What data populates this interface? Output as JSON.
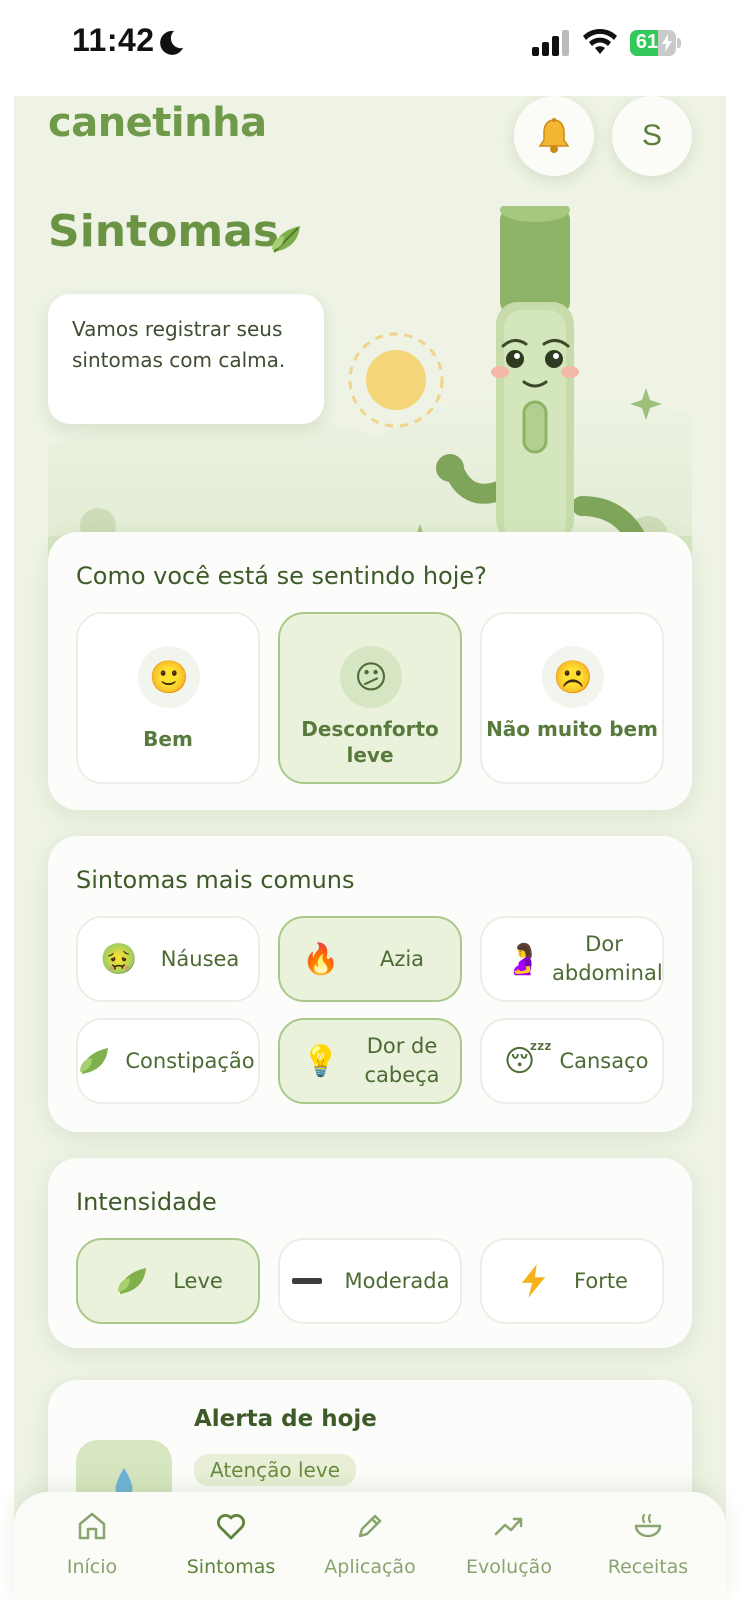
{
  "status_bar": {
    "time": "11:42",
    "battery_percent": 61,
    "battery_label": "61",
    "icons": [
      "moon-icon",
      "signal-icon",
      "wifi-icon",
      "battery-charging-icon"
    ]
  },
  "header": {
    "logo": "canetinha",
    "bell_icon": "bell-icon",
    "avatar_letter": "S"
  },
  "hero": {
    "title": "Sintomas",
    "speech": "Vamos registrar seus sintomas com calma.",
    "mascot": "pen-mascot-illustration"
  },
  "mood_card": {
    "title": "Como você está se sentindo hoje?",
    "options": [
      {
        "label": "Bem",
        "emoji": "🙂",
        "selected": false
      },
      {
        "label": "Desconforto leve",
        "emoji": "😕",
        "selected": true
      },
      {
        "label": "Não muito bem",
        "emoji": "☹️",
        "selected": false
      }
    ]
  },
  "symptoms_card": {
    "title": "Sintomas mais comuns",
    "chips": [
      {
        "label": "Náusea",
        "icon": "nauseated-face-icon",
        "selected": false
      },
      {
        "label": "Azia",
        "icon": "fire-icon",
        "selected": true
      },
      {
        "label": "Dor abdominal",
        "icon": "person-stomach-icon",
        "selected": false
      },
      {
        "label": "Constipação",
        "icon": "leaf-icon",
        "selected": false
      },
      {
        "label": "Dor de cabeça",
        "icon": "lightbulb-icon",
        "selected": true
      },
      {
        "label": "Cansaço",
        "icon": "sleeping-face-icon",
        "selected": false
      }
    ]
  },
  "intensity_card": {
    "title": "Intensidade",
    "options": [
      {
        "label": "Leve",
        "icon": "leaf-icon",
        "selected": true
      },
      {
        "label": "Moderada",
        "icon": "dash-icon",
        "selected": false
      },
      {
        "label": "Forte",
        "icon": "lightning-icon",
        "selected": false
      }
    ]
  },
  "alert_card": {
    "title": "Alerta de hoje",
    "badge": "Atenção leve",
    "icon": "droplet-icon"
  },
  "bottom_nav": {
    "items": [
      {
        "label": "Início",
        "icon": "home-icon",
        "active": false
      },
      {
        "label": "Sintomas",
        "icon": "heart-icon",
        "active": true
      },
      {
        "label": "Aplicação",
        "icon": "pencil-icon",
        "active": false
      },
      {
        "label": "Evolução",
        "icon": "trend-up-icon",
        "active": false
      },
      {
        "label": "Receitas",
        "icon": "bowl-icon",
        "active": false
      }
    ]
  },
  "colors": {
    "brand_green": "#6f9a4a",
    "app_background": "#eef3e5",
    "selected_fill": "#eaf2dc",
    "selected_border": "#a9c98a",
    "battery_green": "#34c759"
  }
}
